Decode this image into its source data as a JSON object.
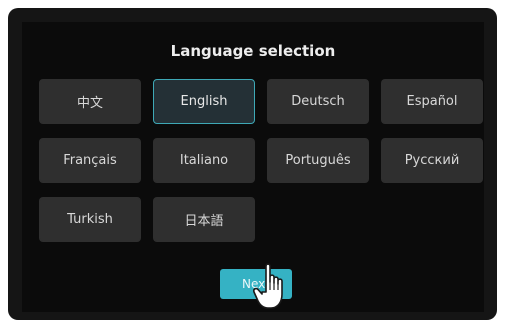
{
  "dialog": {
    "title": "Language selection"
  },
  "languages": [
    {
      "label": "中文",
      "selected": false
    },
    {
      "label": "English",
      "selected": true
    },
    {
      "label": "Deutsch",
      "selected": false
    },
    {
      "label": "Español",
      "selected": false
    },
    {
      "label": "Français",
      "selected": false
    },
    {
      "label": "Italiano",
      "selected": false
    },
    {
      "label": "Português",
      "selected": false
    },
    {
      "label": "Русский",
      "selected": false
    },
    {
      "label": "Turkish",
      "selected": false
    },
    {
      "label": "日本語",
      "selected": false
    }
  ],
  "next_button": {
    "label": "Next"
  },
  "pointer": {
    "icon": "hand-pointer-icon"
  },
  "colors": {
    "accent": "#35b2c4",
    "selected_border": "#3ea8b6",
    "button_bg": "#2f2f2f",
    "screen_bg": "#0b0b0b"
  }
}
